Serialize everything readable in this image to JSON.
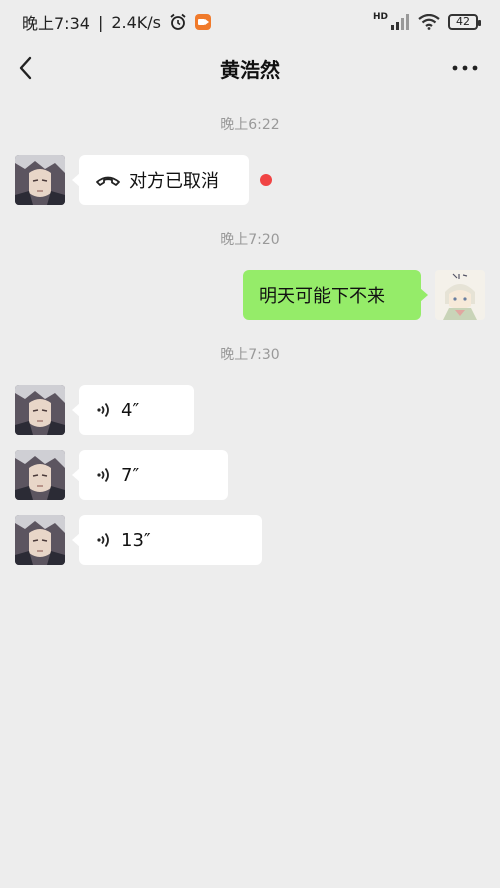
{
  "statusbar": {
    "time": "晚上7:34",
    "net_speed": "2.4K/s",
    "separator": "|",
    "hd_label": "HD",
    "battery": "42"
  },
  "header": {
    "title": "黄浩然"
  },
  "timestamps": [
    "晚上6:22",
    "晚上7:20",
    "晚上7:30"
  ],
  "messages": {
    "call": {
      "text": "对方已取消",
      "unread": true
    },
    "outgoing": {
      "text": "明天可能下不来"
    },
    "voice": [
      {
        "duration": "4″"
      },
      {
        "duration": "7″"
      },
      {
        "duration": "13″"
      }
    ]
  },
  "colors": {
    "background": "#ededed",
    "outgoing_bubble": "#95ec69",
    "incoming_bubble": "#ffffff",
    "unread_dot": "#f04444",
    "recorder_icon": "#f07a2b"
  }
}
